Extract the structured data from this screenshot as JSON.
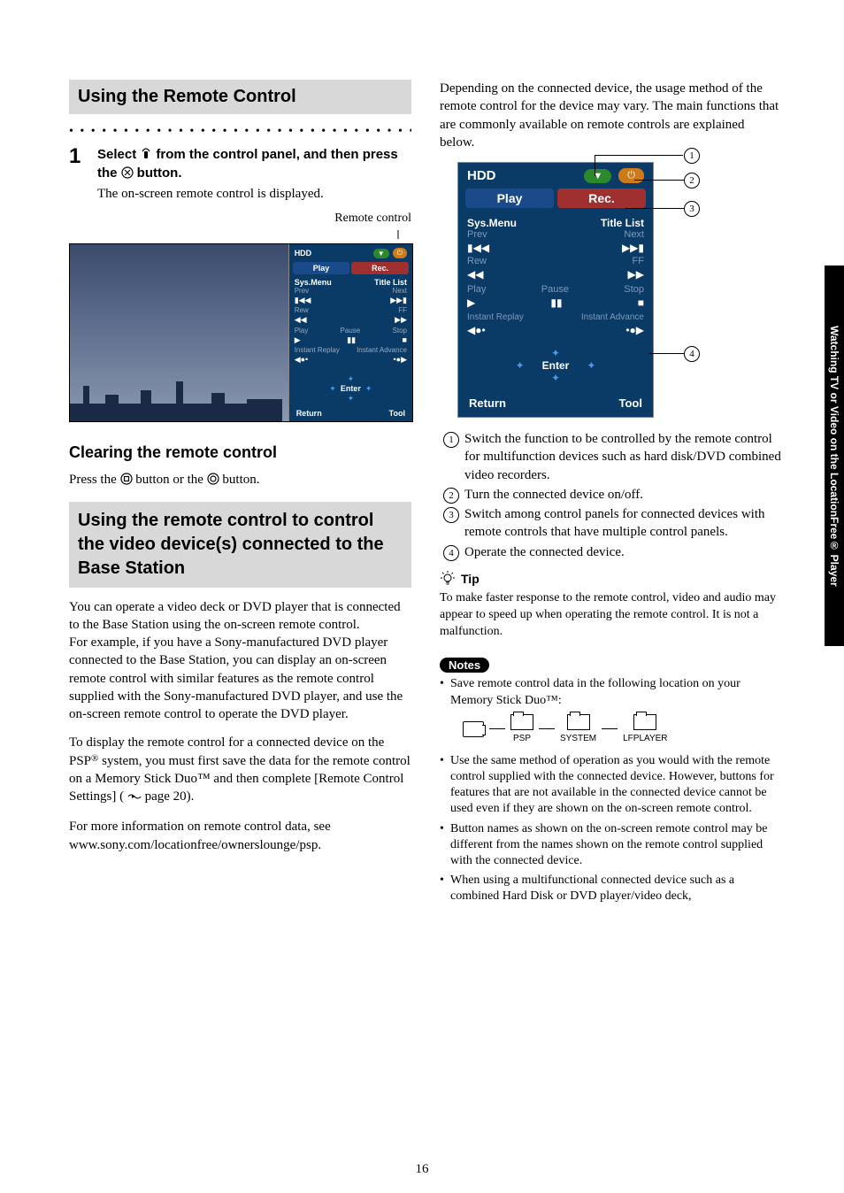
{
  "page_number": "16",
  "side_tab": "Watching TV or Video on the LocationFree® Player",
  "left": {
    "section1_title": "Using the Remote Control",
    "step_num": "1",
    "step_line1_a": "Select ",
    "step_line1_b": " from the control panel, and then press the ",
    "step_line1_c": " button.",
    "step_followup": "The on-screen remote control is displayed.",
    "fig_caption": "Remote control",
    "sub_hdr": "Clearing the remote control",
    "clear_a": "Press the ",
    "clear_b": " button or the ",
    "clear_c": " button.",
    "section2_title": "Using the remote control to control the video device(s) connected to the Base Station",
    "para1": "You can operate a video deck or DVD player that is connected to the Base Station using the on-screen remote control.\nFor example, if you have a Sony-manufactured DVD player connected to the Base Station, you can display an on-screen remote control with similar features as the remote control supplied with the Sony-manufactured DVD player, and use the on-screen remote control to operate the DVD player.",
    "para2_a": "To display the remote control for a connected device on the PSP",
    "para2_reg": "®",
    "para2_b": " system, you must first save the data for the remote control on a Memory Stick Duo™ and then complete [Remote Control Settings] (",
    "para2_pageref": " page 20).",
    "para3": "For more information on remote control data, see www.sony.com/locationfree/ownerslounge/psp."
  },
  "right": {
    "intro": "Depending on the connected device, the usage method of the remote control for the device may vary. The main functions that are commonly available on remote controls are explained below.",
    "remote": {
      "hdd": "HDD",
      "play_tab": "Play",
      "rec_tab": "Rec.",
      "sysmenu": "Sys.Menu",
      "titlelist": "Title List",
      "prev": "Prev",
      "next": "Next",
      "rew": "Rew",
      "ff": "FF",
      "play": "Play",
      "pause": "Pause",
      "stop": "Stop",
      "ireplay": "Instant Replay",
      "iadvance": "Instant Advance",
      "enter": "Enter",
      "return": "Return",
      "tool": "Tool"
    },
    "callouts": {
      "c1": "Switch the function to be controlled by the remote control for multifunction devices such as hard disk/DVD combined video recorders.",
      "c2": "Turn the connected device on/off.",
      "c3": "Switch among control panels for connected devices with remote controls that have multiple control panels.",
      "c4": "Operate the connected device."
    },
    "tip_label": "Tip",
    "tip_text": "To make faster response to the remote control, video and audio may appear to speed up when operating the remote control. It is not a malfunction.",
    "notes_label": "Notes",
    "note1": "Save remote control data in the following location on your Memory Stick Duo™:",
    "path": {
      "psp": "PSP",
      "system": "SYSTEM",
      "lfplayer": "LFPLAYER"
    },
    "note2": "Use the same method of operation as you would with the remote control supplied with the connected device. However, buttons for features that are not available in the connected device cannot be used even if they are shown on the on-screen remote control.",
    "note3": "Button names as shown on the on-screen remote control may be different from the names shown on the remote control supplied with the connected device.",
    "note4": "When using a multifunctional connected device such as a combined Hard Disk or DVD player/video deck,"
  }
}
